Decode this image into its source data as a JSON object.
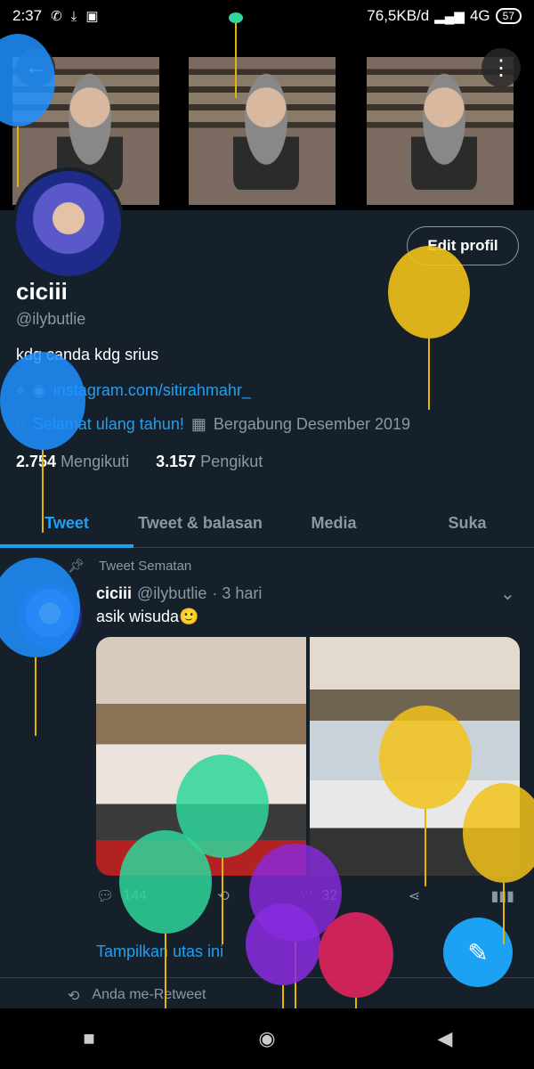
{
  "statusbar": {
    "time": "2:37",
    "speed": "76,5KB/d",
    "network": "4G",
    "battery": "57"
  },
  "profile": {
    "name": "ciciii",
    "handle": "@ilybutlie",
    "bio": "kdg canda kdg srius",
    "link": "instagram.com/sitirahmahr_",
    "birthday": "Selamat ulang tahun!",
    "joined": "Bergabung Desember 2019",
    "following_count": "2.754",
    "following_label": "Mengikuti",
    "followers_count": "3.157",
    "followers_label": "Pengikut",
    "edit_label": "Edit profil"
  },
  "tabs": [
    {
      "label": "Tweet"
    },
    {
      "label": "Tweet & balasan"
    },
    {
      "label": "Media"
    },
    {
      "label": "Suka"
    }
  ],
  "tweet": {
    "pinned_label": "Tweet Sematan",
    "name": "ciciii",
    "handle": "@ilybutlie",
    "time": "· 3 hari",
    "text": "asik wisuda🙂",
    "reply_count": "144",
    "like_count": "32",
    "show_thread": "Tampilkan utas ini"
  },
  "retweet_label": "Anda me-Retweet",
  "colors": {
    "accent": "#1da1f2",
    "background": "#15202b",
    "muted": "#8899a6"
  },
  "icons": {
    "back": "arrow-left-icon",
    "more": "more-vertical-icon",
    "pin": "pin-icon",
    "location": "location-icon",
    "balloon": "balloon-icon",
    "calendar": "calendar-icon",
    "reply": "reply-icon",
    "retweet": "retweet-icon",
    "like": "heart-icon",
    "share": "share-icon",
    "analytics": "analytics-icon",
    "compose": "compose-icon"
  }
}
